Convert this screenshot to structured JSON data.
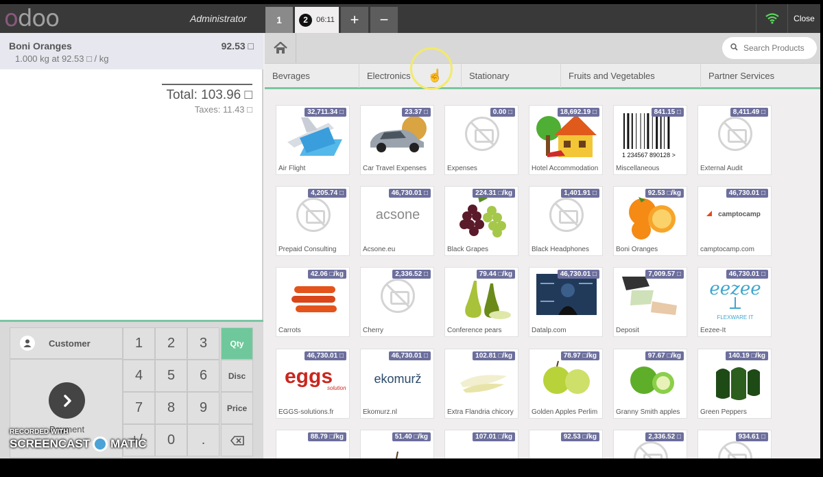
{
  "header": {
    "logo": "odoo",
    "user": "Administrator",
    "orders": [
      {
        "label": "1"
      },
      {
        "label": "2",
        "time": "06:11"
      }
    ],
    "add_label": "+",
    "remove_label": "−",
    "close_label": "Close"
  },
  "order": {
    "line": {
      "name": "Boni Oranges",
      "price": "92.53 □",
      "detail": "1.000 kg at 92.53 □ / kg"
    },
    "total": "Total: 103.96 □",
    "taxes": "Taxes: 11.43 □"
  },
  "controls": {
    "customer_label": "Customer",
    "payment_label": "Payment",
    "numpad": [
      "1",
      "2",
      "3",
      "4",
      "5",
      "6",
      "7",
      "8",
      "9",
      "+/-",
      "0",
      "."
    ],
    "modes": [
      "Qty",
      "Disc",
      "Price"
    ],
    "active_mode": "Qty",
    "backspace_icon": "backspace-icon"
  },
  "search": {
    "placeholder": "Search Products"
  },
  "categories": [
    "Bevrages",
    "Electronics",
    "Stationary",
    "Fruits and Vegetables",
    "Partner Services"
  ],
  "products": [
    {
      "name": "Air Flight",
      "price": "32,711.34 □",
      "icon": "airplane-ticket"
    },
    {
      "name": "Car Travel Expenses",
      "price": "23.37 □",
      "icon": "car"
    },
    {
      "name": "Expenses",
      "price": "0.00 □",
      "icon": "no-image"
    },
    {
      "name": "Hotel Accommodation",
      "price": "18,692.19 □",
      "icon": "house"
    },
    {
      "name": "Miscellaneous",
      "price": "841.15 □",
      "icon": "barcode"
    },
    {
      "name": "External Audit",
      "price": "8,411.49 □",
      "icon": "no-image"
    },
    {
      "name": "Prepaid Consulting",
      "price": "4,205.74 □",
      "icon": "no-image"
    },
    {
      "name": "Acsone.eu",
      "price": "46,730.01 □",
      "icon": "acsone-logo",
      "logo_text": "acsone"
    },
    {
      "name": "Black Grapes",
      "price": "224.31 □/kg",
      "icon": "grapes"
    },
    {
      "name": "Black Headphones",
      "price": "1,401.91 □",
      "icon": "no-image"
    },
    {
      "name": "Boni Oranges",
      "price": "92.53 □/kg",
      "icon": "oranges"
    },
    {
      "name": "camptocamp.com",
      "price": "46,730.01 □",
      "icon": "camptocamp-logo",
      "logo_text": "camptocamp"
    },
    {
      "name": "Carrots",
      "price": "42.06 □/kg",
      "icon": "carrots"
    },
    {
      "name": "Cherry",
      "price": "2,336.52 □",
      "icon": "no-image"
    },
    {
      "name": "Conference pears",
      "price": "79.44 □/kg",
      "icon": "pears"
    },
    {
      "name": "Datalp.com",
      "price": "46,730.01 □",
      "icon": "datalp-image"
    },
    {
      "name": "Deposit",
      "price": "7,009.57 □",
      "icon": "money-hands"
    },
    {
      "name": "Eezee-It",
      "price": "46,730.01 □",
      "icon": "eezee-logo",
      "logo_text": "eezee",
      "logo_sub": "FLEXWARE IT"
    },
    {
      "name": "EGGS-solutions.fr",
      "price": "46,730.01 □",
      "icon": "eggs-logo",
      "logo_text": "eggs",
      "logo_sub": "solutions"
    },
    {
      "name": "Ekomurz.nl",
      "price": "46,730.01 □",
      "icon": "ekomurz-logo",
      "logo_text": "ekomurž"
    },
    {
      "name": "Extra Flandria chicory",
      "price": "102.81 □/kg",
      "icon": "chicory"
    },
    {
      "name": "Golden Apples Perlim",
      "price": "78.97 □/kg",
      "icon": "golden-apples"
    },
    {
      "name": "Granny Smith apples",
      "price": "97.67 □/kg",
      "icon": "green-apples"
    },
    {
      "name": "Green Peppers",
      "price": "140.19 □/kg",
      "icon": "green-peppers"
    },
    {
      "name": "",
      "price": "88.79 □/kg",
      "icon": "tomatoes"
    },
    {
      "name": "",
      "price": "51.40 □/kg",
      "icon": "red-apples"
    },
    {
      "name": "",
      "price": "107.01 □/kg",
      "icon": "leeks"
    },
    {
      "name": "",
      "price": "92.53 □/kg",
      "icon": "lemons"
    },
    {
      "name": "",
      "price": "2,336.52 □",
      "icon": "no-image"
    },
    {
      "name": "",
      "price": "934.61 □",
      "icon": "no-image"
    }
  ],
  "watermark": {
    "top": "RECORDED WITH",
    "left": "SCREENCAST",
    "right": "MATIC"
  },
  "colors": {
    "accent": "#7ac5a2",
    "price_tag": "#6c6e9c",
    "header": "#393939",
    "odoo_purple": "#875a7b"
  }
}
